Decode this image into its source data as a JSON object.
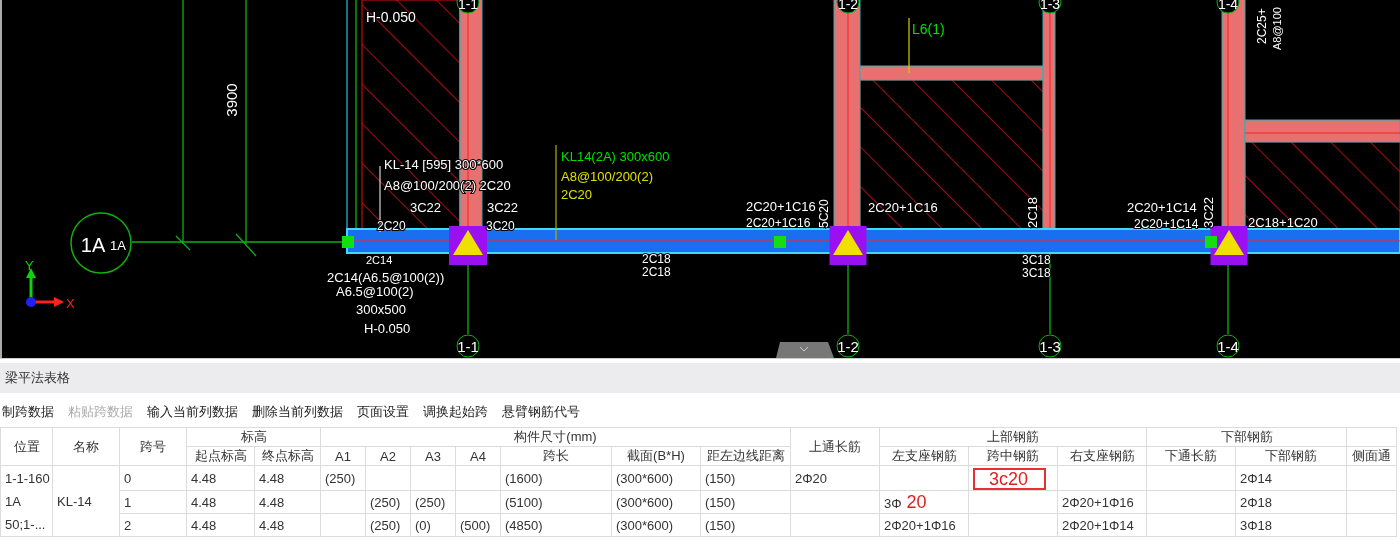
{
  "canvas": {
    "labels": [
      {
        "text": "H-0.050",
        "color": "#ffffff"
      },
      {
        "text": "3900",
        "color": "#ffffff"
      },
      {
        "text": "1A",
        "color": "#ffffff"
      },
      {
        "text": "1A",
        "color": "#ffffff"
      },
      {
        "text": "KL-14 [595] 300*600",
        "color": "#ffffff"
      },
      {
        "text": "A8@100/200(2) 2C20",
        "color": "#ffffff"
      },
      {
        "text": "3C22",
        "color": "#ffffff"
      },
      {
        "text": "3C22",
        "color": "#ffffff"
      },
      {
        "text": "2C20",
        "color": "#ffffff"
      },
      {
        "text": "3C20",
        "color": "#ffffff"
      },
      {
        "text": "KL14(2A) 300x600",
        "color": "#00e000"
      },
      {
        "text": "A8@100/200(2)",
        "color": "#e0e000"
      },
      {
        "text": "2C20",
        "color": "#e0e000"
      },
      {
        "text": "2C14",
        "color": "#ffffff"
      },
      {
        "text": "2C14(A6.5@100(2))",
        "color": "#ffffff"
      },
      {
        "text": "A6.5@100(2)",
        "color": "#ffffff"
      },
      {
        "text": "300x500",
        "color": "#ffffff"
      },
      {
        "text": "H-0.050",
        "color": "#ffffff"
      },
      {
        "text": "2C18",
        "color": "#ffffff"
      },
      {
        "text": "2C18",
        "color": "#ffffff"
      },
      {
        "text": "2C20+1C16",
        "color": "#ffffff"
      },
      {
        "text": "2C20+1C16",
        "color": "#ffffff"
      },
      {
        "text": "2C20+1C16",
        "color": "#ffffff"
      },
      {
        "text": "3C18",
        "color": "#ffffff"
      },
      {
        "text": "3C18",
        "color": "#ffffff"
      },
      {
        "text": "2C20+1C14",
        "color": "#ffffff"
      },
      {
        "text": "2C20+1C14",
        "color": "#ffffff"
      },
      {
        "text": "2C18+1C20",
        "color": "#ffffff"
      },
      {
        "text": "L6(1)",
        "color": "#00e000"
      },
      {
        "text": "2C25+",
        "color": "#ffffff"
      },
      {
        "text": "A8@100",
        "color": "#ffffff"
      },
      {
        "text": "5C20",
        "color": "#ffffff"
      },
      {
        "text": "3C22",
        "color": "#ffffff"
      },
      {
        "text": "2C18",
        "color": "#ffffff"
      }
    ],
    "top_axis_labels": [
      "1-1",
      "1-2",
      "1-3",
      "1-4"
    ],
    "bottom_axis_labels": [
      "1-1",
      "1-2",
      "1-3",
      "1-4"
    ],
    "axis_icon": {
      "x_label": "X",
      "y_label": "Y"
    }
  },
  "panel": {
    "title": "梁平法表格",
    "toolbar": [
      {
        "label": "制跨数据",
        "disabled": false
      },
      {
        "label": "粘贴跨数据",
        "disabled": true
      },
      {
        "label": "输入当前列数据",
        "disabled": false
      },
      {
        "label": "删除当前列数据",
        "disabled": false
      },
      {
        "label": "页面设置",
        "disabled": false
      },
      {
        "label": "调换起始跨",
        "disabled": false
      },
      {
        "label": "悬臂钢筋代号",
        "disabled": false
      }
    ],
    "table": {
      "header_groups": [
        {
          "label": "位置"
        },
        {
          "label": "名称"
        },
        {
          "label": "跨号"
        },
        {
          "label": "标高",
          "columns": [
            "起点标高",
            "终点标高"
          ]
        },
        {
          "label": "构件尺寸(mm)",
          "columns": [
            "A1",
            "A2",
            "A3",
            "A4",
            "跨长",
            "截面(B*H)",
            "距左边线距离"
          ]
        },
        {
          "label": "上通长筋"
        },
        {
          "label": "上部钢筋",
          "columns": [
            "左支座钢筋",
            "跨中钢筋",
            "右支座钢筋"
          ]
        },
        {
          "label": "下部钢筋",
          "columns": [
            "下通长筋",
            "下部钢筋"
          ]
        },
        {
          "columns": [
            "侧面通"
          ]
        }
      ],
      "location": [
        "1-1-160",
        "1A",
        "50;1-..."
      ],
      "name": "KL-14",
      "rows": [
        {
          "cells": [
            "0",
            "4.48",
            "4.48",
            "(250)",
            null,
            null,
            null,
            "(1600)",
            "(300*600)",
            "(150)",
            "2Φ20",
            null,
            {
              "kind": "editing",
              "value": "3c20"
            },
            null,
            null,
            "2Φ14",
            null
          ]
        },
        {
          "cells": [
            "1",
            "4.48",
            "4.48",
            null,
            "(250)",
            "(250)",
            null,
            "(5100)",
            "(300*600)",
            "(150)",
            null,
            {
              "kind": "typing",
              "text": "3Φ",
              "typed": "20"
            },
            null,
            "2Φ20+1Φ16",
            null,
            "2Φ18",
            null
          ]
        },
        {
          "cells": [
            "2",
            "4.48",
            "4.48",
            null,
            "(250)",
            "(0)",
            "(500)",
            "(4850)",
            "(300*600)",
            "(150)",
            null,
            "2Φ20+1Φ16",
            null,
            "2Φ20+1Φ14",
            null,
            "3Φ18",
            null
          ]
        }
      ]
    }
  }
}
